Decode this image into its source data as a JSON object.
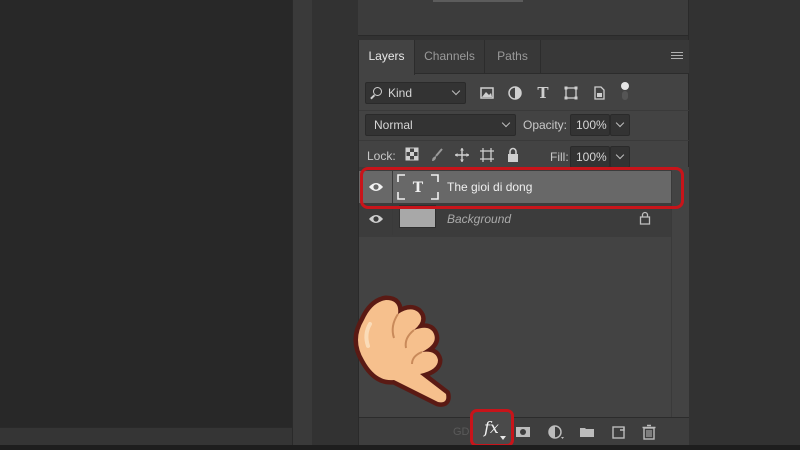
{
  "tabs": [
    "Layers",
    "Channels",
    "Paths"
  ],
  "filter": {
    "kind_label": "Kind"
  },
  "blend": {
    "mode": "Normal",
    "opacity_label": "Opacity:",
    "opacity_value": "100%",
    "fill_label": "Fill:",
    "fill_value": "100%",
    "lock_label": "Lock:"
  },
  "layers": [
    {
      "name": "The gioi di dong",
      "type": "text",
      "selected": true,
      "thumb_glyph": "T"
    },
    {
      "name": "Background",
      "type": "background",
      "selected": false,
      "locked": true
    }
  ],
  "toolbar": {
    "fx_label": "fx"
  },
  "colors": {
    "highlight": "#c8141a",
    "panel": "#434343",
    "selected_row": "#686868"
  }
}
